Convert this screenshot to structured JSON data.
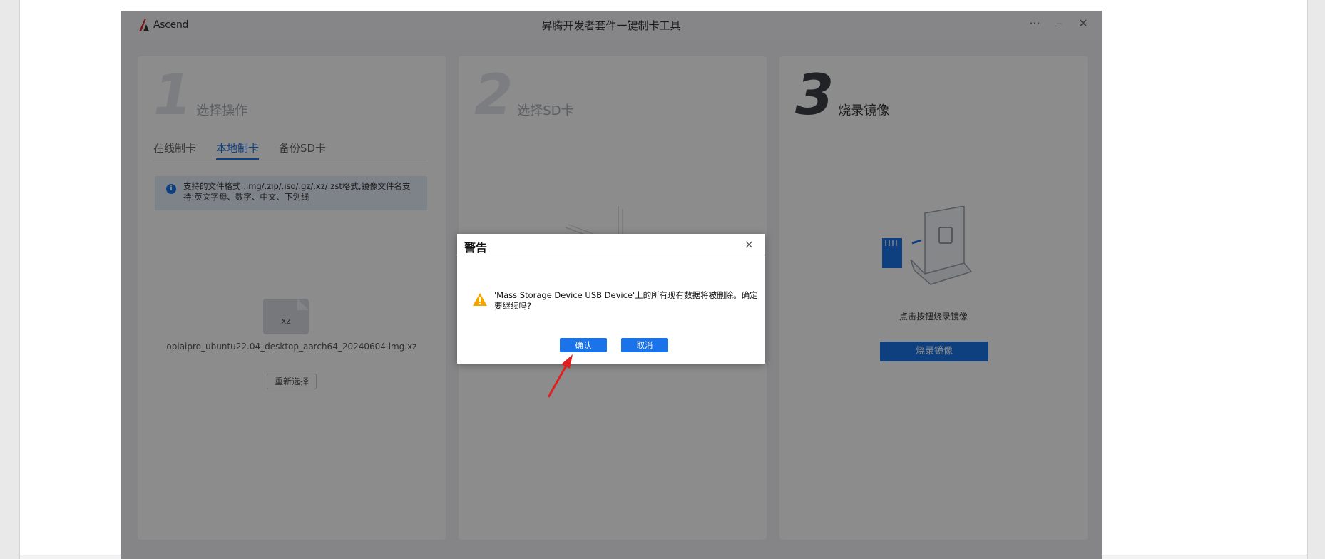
{
  "window": {
    "logo_text": "Ascend",
    "title": "昇腾开发者套件一键制卡工具",
    "controls": [
      "···",
      "–",
      "✕"
    ]
  },
  "panel1": {
    "step_number": "1",
    "step_label": "选择操作",
    "tabs": [
      "在线制卡",
      "本地制卡",
      "备份SD卡"
    ],
    "active_tab": "本地制卡",
    "info_text": "支持的文件格式:.img/.zip/.iso/.gz/.xz/.zst格式,镜像文件名支持:英文字母、数字、中文、下划线",
    "file_ext": "xz",
    "file_name": "opiaipro_ubuntu22.04_desktop_aarch64_20240604.img.xz",
    "reselect_label": "重新选择"
  },
  "panel2": {
    "step_number": "2",
    "step_label": "选择SD卡"
  },
  "panel3": {
    "step_number": "3",
    "step_label": "烧录镜像",
    "hint": "点击按钮烧录镜像",
    "burn_label": "烧录镜像"
  },
  "dialog": {
    "title": "警告",
    "close": "×",
    "message": "'Mass Storage Device USB Device'上的所有现有数据将被删除。确定要继续吗?",
    "ok_label": "确认",
    "cancel_label": "取消"
  },
  "colors": {
    "accent": "#1a73e8",
    "overlay": "rgba(0,0,0,0.45)",
    "warning": "#f0a500",
    "annotation_arrow": "#e02020"
  },
  "icons": {
    "logo": "ascend-logo-icon",
    "info": "info-icon",
    "warning": "warning-icon",
    "annotation": "red-arrow-annotation"
  }
}
